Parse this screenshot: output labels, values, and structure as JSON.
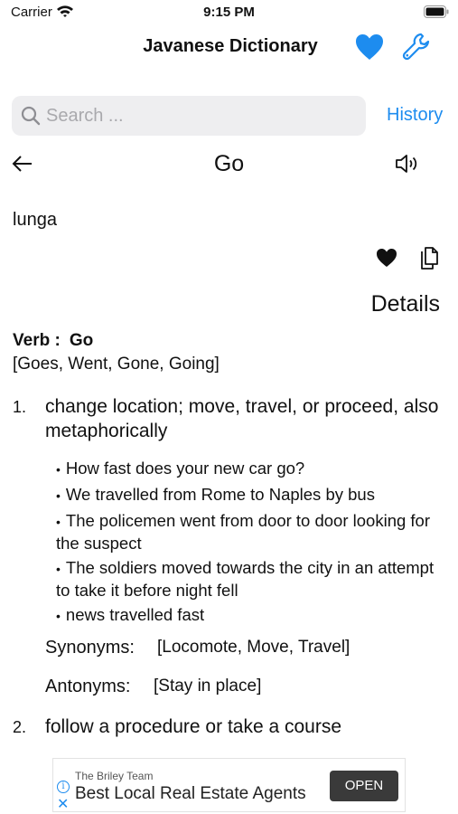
{
  "status_bar": {
    "carrier": "Carrier",
    "time": "9:15 PM"
  },
  "nav": {
    "title": "Javanese Dictionary"
  },
  "search": {
    "placeholder": "Search ...",
    "value": "",
    "history_label": "History"
  },
  "entry": {
    "word": "Go",
    "translation": "lunga",
    "details_heading": "Details",
    "part_of_speech": "Verb :",
    "headword": "Go",
    "forms": "[Goes, Went, Gone, Going]",
    "senses": [
      {
        "number": "1.",
        "definition": "change location; move, travel, or proceed, also metaphorically",
        "examples": [
          "How fast does your new car go?",
          "We travelled from Rome to Naples by bus",
          "The policemen went from door to door looking for the suspect",
          "The soldiers moved towards the city in an attempt to take it before night fell",
          "news travelled fast"
        ],
        "synonyms_label": "Synonyms:",
        "synonyms": "[Locomote, Move, Travel]",
        "antonyms_label": "Antonyms:",
        "antonyms": "[Stay in place]"
      },
      {
        "number": "2.",
        "definition": "follow a procedure or take a course"
      }
    ]
  },
  "ad": {
    "advertiser": "The Briley Team",
    "headline": "Best Local Real Estate Agents",
    "cta": "OPEN"
  },
  "colors": {
    "accent": "#1d8cef",
    "search_bg": "#eeeef0",
    "ad_button": "#3a3a3a"
  },
  "icons": [
    "wifi-icon",
    "battery-icon",
    "heart-icon",
    "wrench-icon",
    "search-icon",
    "back-arrow-icon",
    "speaker-icon",
    "heart-icon",
    "copy-icon",
    "info-icon",
    "close-icon"
  ]
}
